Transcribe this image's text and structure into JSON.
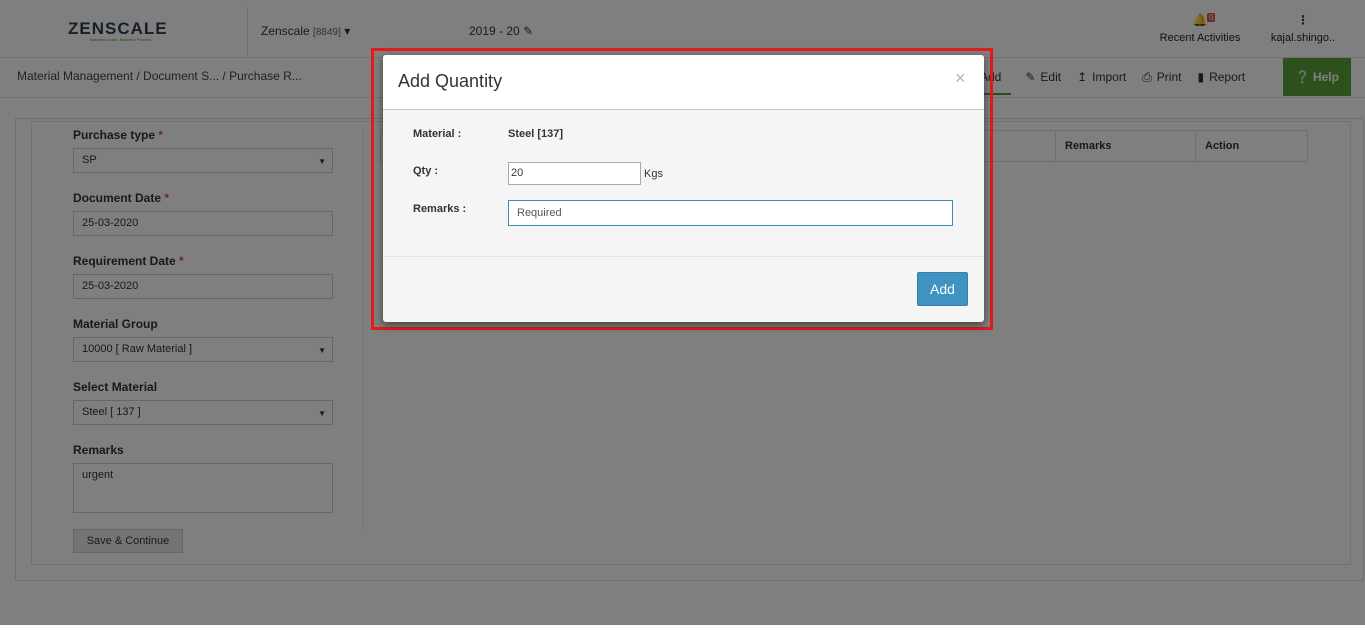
{
  "header": {
    "logo_text": "ZENSCALE",
    "logo_tagline": "Business Scale. Business Process",
    "company_name": "Zenscale",
    "company_code": "[8849]",
    "financial_year": "2019 - 20",
    "notification_count": "0",
    "recent_activities_label": "Recent Activities",
    "user_label": "kajal.shingo.."
  },
  "breadcrumb": "Material Management  / Document S... / Purchase R...",
  "toolbar": {
    "add_label": "Add",
    "edit_label": "Edit",
    "import_label": "Import",
    "print_label": "Print",
    "report_label": "Report",
    "help_label": "Help"
  },
  "form": {
    "purchase_type_label": "Purchase type",
    "purchase_type_value": "SP",
    "document_date_label": "Document Date",
    "document_date_value": "25-03-2020",
    "requirement_date_label": "Requirement Date",
    "requirement_date_value": "25-03-2020",
    "material_group_label": "Material Group",
    "material_group_value": "10000 [ Raw Material ]",
    "select_material_label": "Select Material",
    "select_material_value": "Steel [ 137 ]",
    "remarks_label": "Remarks",
    "remarks_value": "urgent",
    "save_button": "Save & Continue",
    "required_marker": "*"
  },
  "table": {
    "columns": [
      "Remarks",
      "Action"
    ]
  },
  "modal": {
    "title": "Add Quantity",
    "close_symbol": "×",
    "material_label": "Material :",
    "material_value": "Steel [137]",
    "qty_label": "Qty :",
    "qty_value": "20",
    "qty_unit": "Kgs",
    "remarks_label": "Remarks :",
    "remarks_value": "Required",
    "add_button": "Add"
  },
  "colors": {
    "help_green": "#5aa23a",
    "add_button_blue": "#3f93c0",
    "highlight_red": "#e31b1b",
    "required_red": "#d9534f"
  }
}
